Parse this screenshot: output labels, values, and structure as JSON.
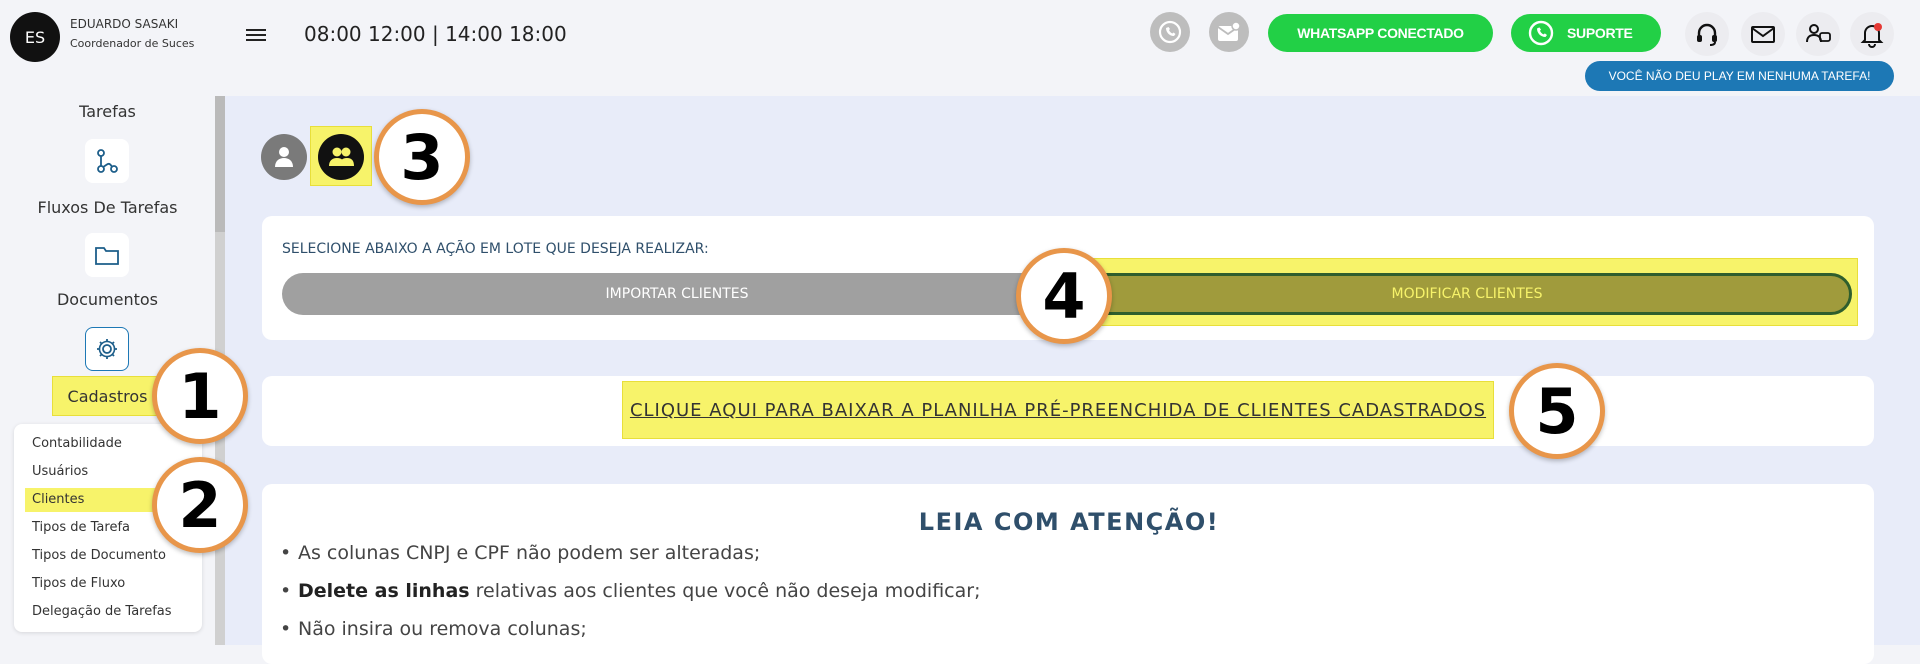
{
  "header": {
    "avatar_initials": "ES",
    "user_name": "EDUARDO SASAKI",
    "user_role": "Coordenador de Suces",
    "hours": "08:00 12:00 | 14:00 18:00",
    "whatsapp_label": "WHATSAPP CONECTADO",
    "suporte_label": "SUPORTE",
    "notification": "VOCÊ NÃO DEU PLAY EM NENHUMA TAREFA!",
    "accent_green": "#22d046",
    "accent_blue": "#1d78b5"
  },
  "sidebar": {
    "items": [
      {
        "label": "Tarefas"
      },
      {
        "label": "Fluxos De Tarefas",
        "icon": "workflow-icon"
      },
      {
        "label": "Documentos",
        "icon": "folder-icon"
      },
      {
        "label": "Cadastros",
        "icon": "gear-icon"
      }
    ],
    "submenu": [
      "Contabilidade",
      "Usuários",
      "Clientes",
      "Tipos de Tarefa",
      "Tipos de Documento",
      "Tipos de Fluxo",
      "Delegação de Tarefas"
    ]
  },
  "main": {
    "batch_prompt": "SELECIONE ABAIXO A AÇÃO EM LOTE QUE DESEJA REALIZAR:",
    "import_label": "IMPORTAR CLIENTES",
    "modify_label": "MODIFICAR CLIENTES",
    "download_link": "CLIQUE AQUI PARA BAIXAR A PLANILHA PRÉ-PREENCHIDA DE CLIENTES CADASTRADOS",
    "read_title": "LEIA COM ATENÇÃO!",
    "bullets": [
      {
        "bold": "",
        "text": "As colunas CNPJ e CPF não podem ser alteradas;"
      },
      {
        "bold": "Delete as linhas",
        "text": " relativas aos clientes que você não deseja modificar;"
      },
      {
        "bold": "",
        "text": "Não insira ou remova colunas;"
      }
    ]
  },
  "callouts": [
    "1",
    "2",
    "3",
    "4",
    "5"
  ],
  "highlight_color": "#f7f36a",
  "callout_border_color": "#e8964a"
}
